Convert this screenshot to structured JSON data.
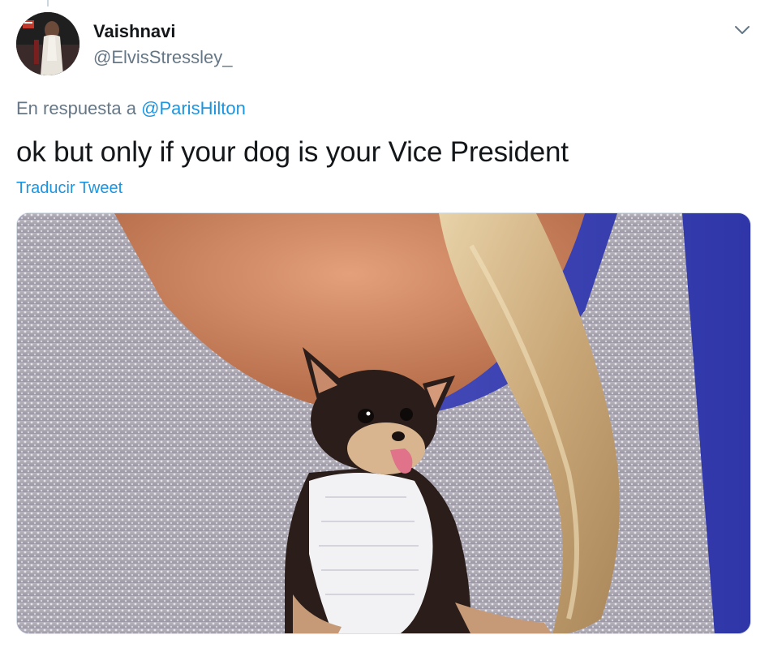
{
  "tweet": {
    "author": {
      "display_name": "Vaishnavi",
      "handle": "@ElvisStressley_",
      "avatar_icon": "profile-photo"
    },
    "reply_context": {
      "prefix": "En respuesta a ",
      "mention": "@ParisHilton"
    },
    "text": "ok but only if your dog is your Vice President",
    "translate_label": "Traducir Tweet",
    "media": {
      "description_icon": "photo-chihuahua-in-white-vest"
    },
    "menu_icon": "chevron-down-icon"
  },
  "colors": {
    "link": "#1b95e0",
    "secondary_text": "#657786",
    "primary_text": "#14171a"
  }
}
